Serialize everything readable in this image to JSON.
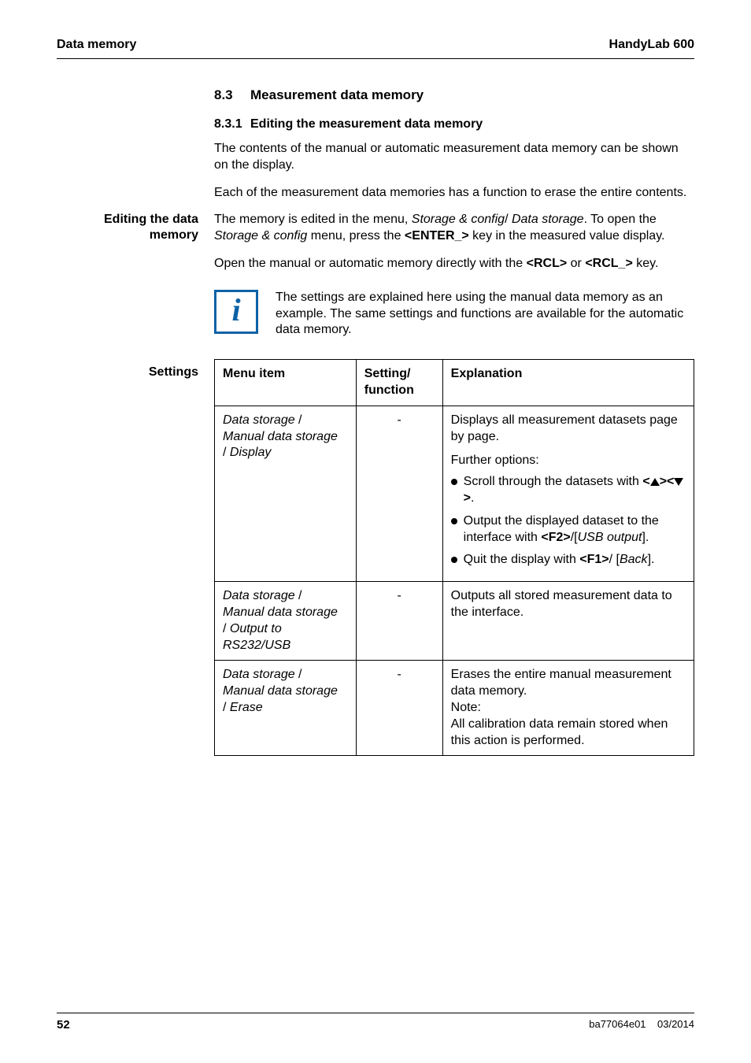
{
  "header": {
    "left": "Data memory",
    "right": "HandyLab 600"
  },
  "section": {
    "num": "8.3",
    "title": "Measurement data memory"
  },
  "subsection": {
    "num": "8.3.1",
    "title": "Editing the measurement data memory"
  },
  "intro": {
    "p1": "The contents of the manual or automatic measurement data memory can be shown on the display.",
    "p2": "Each of the measurement data memories has a function to erase the entire contents."
  },
  "editing": {
    "label_l1": "Editing the data",
    "label_l2": "memory",
    "p1_a": "The memory is edited in the menu, ",
    "p1_i1": "Storage & config",
    "p1_b": "/ ",
    "p1_i2": "Data storage",
    "p1_c": ". To open the ",
    "p1_i3": "Storage & config",
    "p1_d": " menu, press the ",
    "p1_key": "<ENTER_>",
    "p1_e": " key in the measured value display.",
    "p2_a": "Open the manual or automatic memory directly with the ",
    "p2_k1": "<RCL>",
    "p2_b": " or ",
    "p2_k2": "<RCL_>",
    "p2_c": " key."
  },
  "info": {
    "text": "The settings are explained here using the manual data memory as an example. The same settings and functions are available for the automatic data memory."
  },
  "settings": {
    "label": "Settings",
    "th1": "Menu item",
    "th2_l1": "Setting/",
    "th2_l2": "function",
    "th3": "Explanation",
    "rows": [
      {
        "menu_l1_i": "Data storage",
        "menu_l1_t": " / ",
        "menu_l2_i": "Manual data storage",
        "menu_l3_t": " / ",
        "menu_l3_i": "Display",
        "setting": "-",
        "exp_p1": "Displays all measurement datasets page by page.",
        "exp_p2": "Further options:",
        "b1_a": "Scroll through the datasets with ",
        "b1_end": ".",
        "b2_a": "Output the displayed dataset to the interface with ",
        "b2_key": "<F2>",
        "b2_b": "/[",
        "b2_i": "USB output",
        "b2_c": "].",
        "b3_a": "Quit the display with ",
        "b3_key": "<F1>",
        "b3_b": "/ [",
        "b3_i": "Back",
        "b3_c": "]."
      },
      {
        "menu_l1_i": "Data storage",
        "menu_l1_t": " / ",
        "menu_l2_i": "Manual data storage",
        "menu_l3_t": " / ",
        "menu_l3_i": "Output to RS232/USB",
        "setting": "-",
        "exp": "Outputs all stored measurement data to the interface."
      },
      {
        "menu_l1_i": "Data storage",
        "menu_l1_t": " / ",
        "menu_l2_i": "Manual data storage",
        "menu_l3_t": " / ",
        "menu_l3_i": "Erase",
        "setting": "-",
        "exp_l1": "Erases the entire manual measurement data memory.",
        "exp_l2": "Note:",
        "exp_l3": "All calibration data remain stored when this action is performed."
      }
    ]
  },
  "keys": {
    "lt": "<",
    "gt": ">"
  },
  "footer": {
    "page": "52",
    "doc": "ba77064e01",
    "date": "03/2014"
  }
}
